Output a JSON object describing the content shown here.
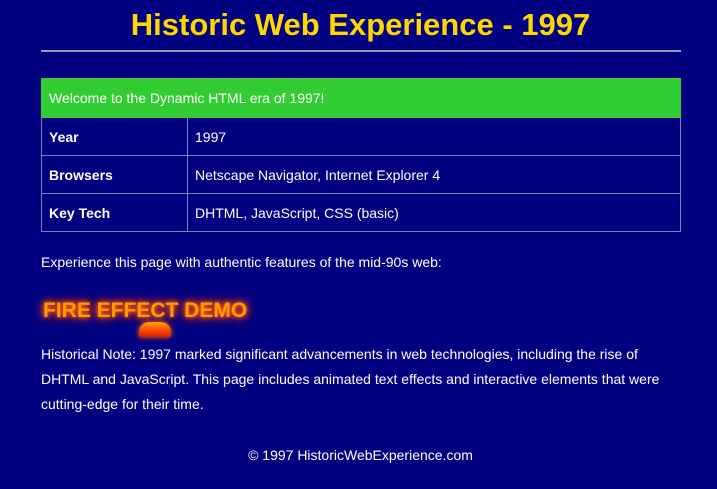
{
  "header": {
    "title": "Historic Web Experience - 1997"
  },
  "info_table": {
    "banner": "Welcome to the Dynamic HTML era of 1997!",
    "banner_color": "#32cd32",
    "rows": [
      {
        "label": "Year",
        "value": "1997"
      },
      {
        "label": "Browsers",
        "value": "Netscape Navigator, Internet Explorer 4"
      },
      {
        "label": "Key Tech",
        "value": "DHTML, JavaScript, CSS (basic)"
      }
    ]
  },
  "intro": "Experience this page with authentic features of the mid-90s web:",
  "fire_demo": {
    "label": "FIRE EFFECT DEMO",
    "color": "#ff9900"
  },
  "historical_note": "Historical Note: 1997 marked significant advancements in web technologies, including the rise of DHTML and JavaScript. This page includes animated text effects and interactive elements that were cutting-edge for their time.",
  "footer": {
    "copyright": "© 1997 HistoricWebExperience.com"
  },
  "theme": {
    "background": "#000080",
    "title_color": "#ffd700"
  }
}
